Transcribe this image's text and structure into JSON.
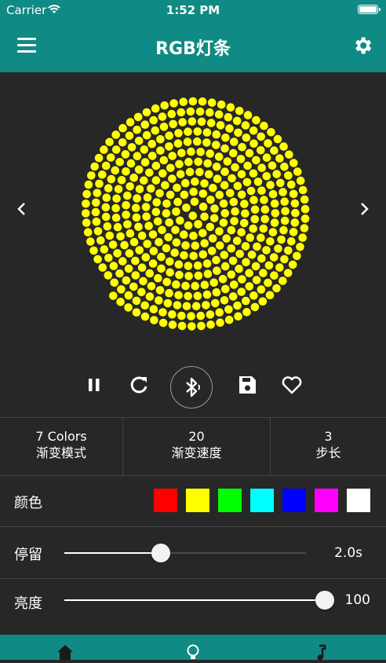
{
  "status_bar": {
    "carrier": "Carrier",
    "time": "1:52 PM"
  },
  "navbar": {
    "title": "RGB灯条",
    "icons": [
      "menu-icon",
      "gear-icon"
    ]
  },
  "pattern": {
    "type": "spiral",
    "led_color": "#ffff00"
  },
  "controls": {
    "icons": [
      "pause-icon",
      "refresh-icon",
      "bluetooth-icon",
      "save-icon",
      "heart-icon"
    ]
  },
  "stats": [
    {
      "value": "7 Colors",
      "label": "渐变模式"
    },
    {
      "value": "20",
      "label": "渐变速度"
    },
    {
      "value": "3",
      "label": "步长"
    }
  ],
  "colors": {
    "label": "颜色",
    "swatches": [
      "#ff0000",
      "#ffff00",
      "#00ff00",
      "#00ffff",
      "#0000ff",
      "#ff00ff",
      "#ffffff"
    ]
  },
  "stay": {
    "label": "停留",
    "value": "2.0s",
    "fraction": 0.4
  },
  "brightness": {
    "label": "亮度",
    "value": "100",
    "fraction": 1.0
  },
  "tabbar": {
    "icons": [
      "home-icon",
      "bulb-icon",
      "music-icon"
    ]
  },
  "theme": {
    "accent": "#0f8a84",
    "background": "#272727"
  }
}
